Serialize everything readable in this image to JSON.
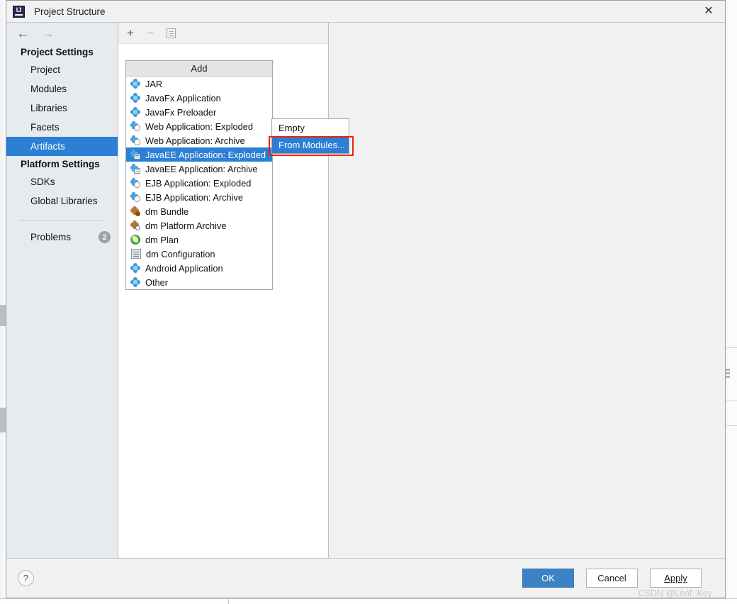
{
  "window": {
    "title": "Project Structure",
    "logo_icon": "intellij-idea-logo",
    "close_icon": "close-icon"
  },
  "nav": {
    "back_icon": "arrow-left-icon",
    "forward_icon": "arrow-right-icon",
    "groups": [
      {
        "title": "Project Settings",
        "items": [
          {
            "label": "Project",
            "selected": false
          },
          {
            "label": "Modules",
            "selected": false
          },
          {
            "label": "Libraries",
            "selected": false
          },
          {
            "label": "Facets",
            "selected": false
          },
          {
            "label": "Artifacts",
            "selected": true
          }
        ]
      },
      {
        "title": "Platform Settings",
        "items": [
          {
            "label": "SDKs",
            "selected": false
          },
          {
            "label": "Global Libraries",
            "selected": false
          }
        ]
      }
    ],
    "problems": {
      "label": "Problems",
      "count": "2"
    }
  },
  "toolbar": {
    "add_icon": "plus-icon",
    "remove_icon": "minus-icon",
    "copy_icon": "copy-icon"
  },
  "add_menu": {
    "header": "Add",
    "items": [
      {
        "label": "JAR",
        "icon": "diamond",
        "selected": false
      },
      {
        "label": "JavaFx Application",
        "icon": "diamond",
        "selected": false
      },
      {
        "label": "JavaFx Preloader",
        "icon": "diamond",
        "selected": false
      },
      {
        "label": "Web Application: Exploded",
        "icon": "globe",
        "selected": false
      },
      {
        "label": "Web Application: Archive",
        "icon": "globe",
        "selected": false
      },
      {
        "label": "JavaEE Application: Exploded",
        "icon": "ee",
        "selected": true
      },
      {
        "label": "JavaEE Application: Archive",
        "icon": "ee",
        "selected": false
      },
      {
        "label": "EJB Application: Exploded",
        "icon": "globe",
        "selected": false
      },
      {
        "label": "EJB Application: Archive",
        "icon": "globe",
        "selected": false
      },
      {
        "label": "dm Bundle",
        "icon": "dmb",
        "selected": false
      },
      {
        "label": "dm Platform Archive",
        "icon": "dmp",
        "selected": false
      },
      {
        "label": "dm Plan",
        "icon": "leaf",
        "selected": false
      },
      {
        "label": "dm Configuration",
        "icon": "doc",
        "selected": false
      },
      {
        "label": "Android Application",
        "icon": "diamond",
        "selected": false
      },
      {
        "label": "Other",
        "icon": "diamond",
        "selected": false
      }
    ]
  },
  "submenu": {
    "items": [
      {
        "label": "Empty",
        "selected": false
      },
      {
        "label": "From Modules...",
        "selected": true
      }
    ]
  },
  "footer": {
    "help_label": "?",
    "ok_label": "OK",
    "cancel_label": "Cancel",
    "apply_label": "Apply",
    "apply_accel": "A",
    "watermark": "CSDN @Leaf_Key"
  },
  "colors": {
    "accent": "#2b7fd4",
    "primary_button": "#3d82c4",
    "annotation": "#ee2211",
    "nav_background": "#e6ebef"
  }
}
